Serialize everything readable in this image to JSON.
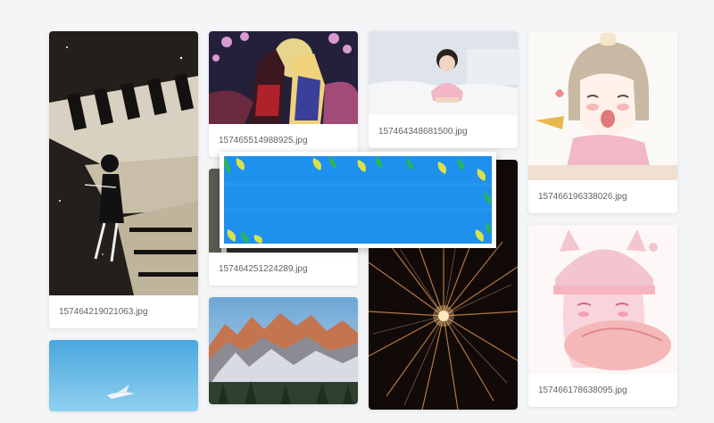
{
  "gallery": {
    "col1": [
      {
        "caption": "157464219021063.jpg",
        "image": "piano-girl-illustration"
      },
      {
        "caption": "",
        "image": "sky-seagull-photo"
      }
    ],
    "col2": [
      {
        "caption": "157465514988925.jpg",
        "image": "anime-couple-illustration"
      },
      {
        "caption": "157464251224289.jpg",
        "image": "dark-photo"
      },
      {
        "caption": "",
        "image": "mountain-landscape-photo"
      }
    ],
    "col3": [
      {
        "caption": "157464348681500.jpg",
        "image": "girl-in-bed-photo"
      },
      {
        "caption": "",
        "image": "fireworks-photo"
      }
    ],
    "col4": [
      {
        "caption": "157466196338026.jpg",
        "image": "crying-girl-sketch"
      },
      {
        "caption": "157466178638095.jpg",
        "image": "girl-with-fish-sketch"
      }
    ]
  },
  "banner": {
    "image": "blue-leaves-banner"
  },
  "colors": {
    "page_bg": "#f4f5f7",
    "caption_text": "#606266",
    "banner_blue": "#1e90ee",
    "leaf_yellow": "#d8e24a",
    "leaf_green": "#2bb35a"
  }
}
